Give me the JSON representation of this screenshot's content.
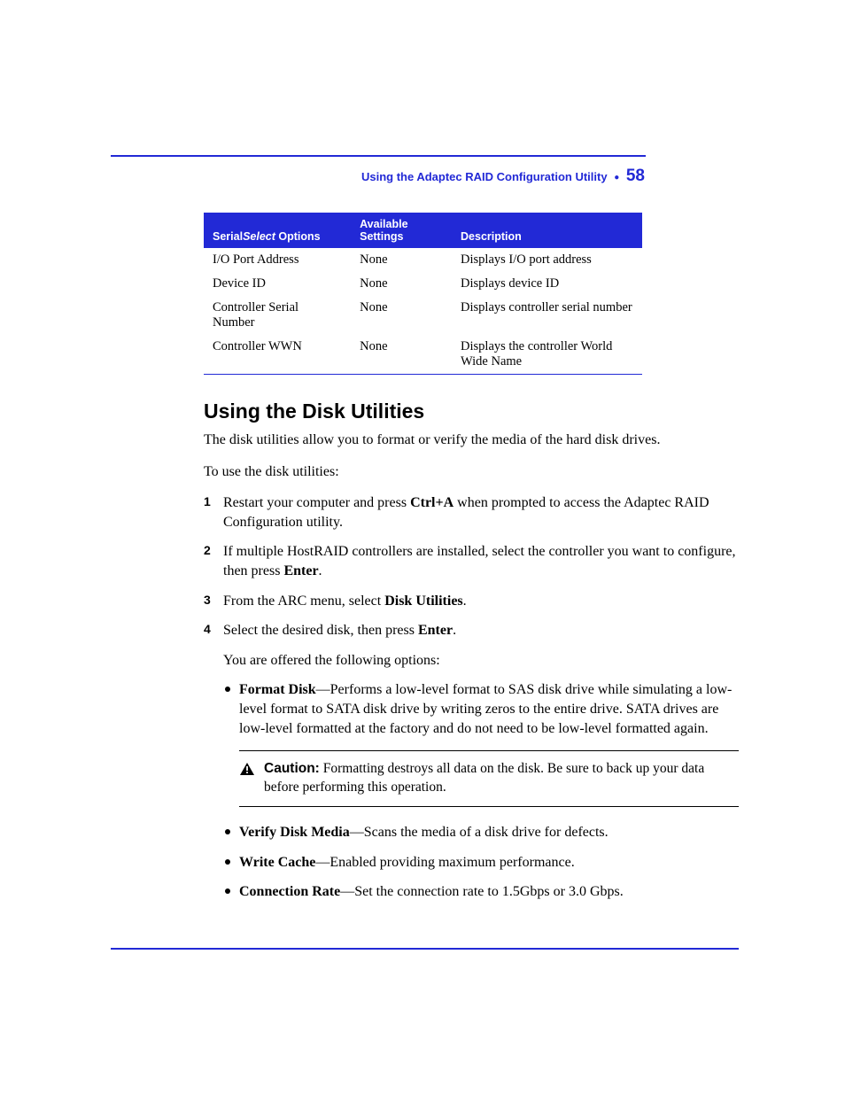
{
  "header": {
    "section_title": "Using the Adaptec RAID Configuration Utility",
    "page_number": "58"
  },
  "table": {
    "headers": {
      "col1_prefix": "Serial",
      "col1_italic": "Select",
      "col1_suffix": " Options",
      "col2": "Available Settings",
      "col3": "Description"
    },
    "rows": [
      {
        "option": "I/O Port Address",
        "settings": "None",
        "desc": "Displays I/O port address"
      },
      {
        "option": "Device ID",
        "settings": "None",
        "desc": "Displays device ID"
      },
      {
        "option": "Controller Serial Number",
        "settings": "None",
        "desc": "Displays controller serial number"
      },
      {
        "option": "Controller WWN",
        "settings": "None",
        "desc": "Displays the controller World Wide Name"
      }
    ]
  },
  "section_heading": "Using the Disk Utilities",
  "intro_para": "The disk utilities allow you to format or verify the media of the hard disk drives.",
  "lead_in": "To use the disk utilities:",
  "steps": {
    "s1_a": "Restart your computer and press ",
    "s1_key": "Ctrl+A",
    "s1_b": " when prompted to access the Adaptec RAID Configuration utility.",
    "s2_a": "If multiple HostRAID controllers are installed, select the controller you want to configure, then press ",
    "s2_key": "Enter",
    "s2_b": ".",
    "s3_a": "From the ARC menu, select ",
    "s3_key": "Disk Utilities",
    "s3_b": ".",
    "s4_a": "Select the desired disk, then press ",
    "s4_key": "Enter",
    "s4_b": ".",
    "s4_sub": "You are offered the following options:"
  },
  "bullets": {
    "b1_label": "Format Disk",
    "b1_text": "—Performs a low-level format to SAS disk drive while simulating a low-level format to SATA disk drive by writing zeros to the entire drive. SATA drives are low-level formatted at the factory and do not need to be low-level formatted again.",
    "b2_label": "Verify Disk Media",
    "b2_text": "—Scans the media of a disk drive for defects.",
    "b3_label": "Write Cache",
    "b3_text": "—Enabled providing maximum performance.",
    "b4_label": "Connection Rate",
    "b4_text": "—Set the connection rate to 1.5Gbps or 3.0 Gbps."
  },
  "caution": {
    "label": "Caution:",
    "text": " Formatting destroys all data on the disk. Be sure to back up your data before performing this operation."
  }
}
